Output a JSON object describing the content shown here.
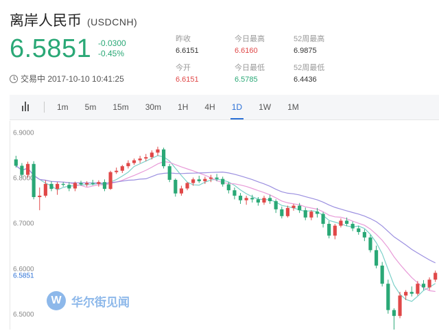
{
  "header": {
    "title": "离岸人民币",
    "symbol": "(USDCNH)"
  },
  "quote": {
    "price": "6.5851",
    "change": "-0.0300",
    "change_pct": "-0.45%",
    "status": "交易中 2017-10-10 10:41:25"
  },
  "stats": [
    {
      "label": "昨收",
      "value": "6.6151",
      "color": "normal"
    },
    {
      "label": "今日最高",
      "value": "6.6160",
      "color": "red"
    },
    {
      "label": "52周最高",
      "value": "6.9875",
      "color": "normal"
    },
    {
      "label": "今开",
      "value": "6.6151",
      "color": "red"
    },
    {
      "label": "今日最低",
      "value": "6.5785",
      "color": "green"
    },
    {
      "label": "52周最低",
      "value": "6.4436",
      "color": "normal"
    }
  ],
  "toolbar": {
    "tabs": [
      "1m",
      "5m",
      "15m",
      "30m",
      "1H",
      "4H",
      "1D",
      "1W",
      "1M"
    ],
    "active": "1D"
  },
  "watermark": {
    "text": "华尔街见闻",
    "glyph": "W"
  },
  "colors": {
    "up": "#e04848",
    "down": "#2aa876",
    "ma1": "#e89ad8",
    "ma2": "#9b8fe0",
    "ma3": "#7ad0c8",
    "current_label": "#2a6fd6"
  },
  "chart_data": {
    "type": "candlestick",
    "ylim": [
      6.465,
      6.925
    ],
    "y_ticks": [
      "6.9000",
      "6.8000",
      "6.7000",
      "6.6000",
      "6.5000"
    ],
    "current_price_label": "6.5851",
    "current_price": 6.5851,
    "candles": [
      [
        6.84,
        6.848,
        6.822,
        6.826
      ],
      [
        6.826,
        6.832,
        6.8,
        6.806
      ],
      [
        6.806,
        6.835,
        6.8,
        6.83
      ],
      [
        6.83,
        6.836,
        6.752,
        6.757
      ],
      [
        6.757,
        6.778,
        6.728,
        6.76
      ],
      [
        6.76,
        6.794,
        6.756,
        6.786
      ],
      [
        6.786,
        6.792,
        6.77,
        6.775
      ],
      [
        6.775,
        6.79,
        6.762,
        6.786
      ],
      [
        6.786,
        6.79,
        6.78,
        6.784
      ],
      [
        6.784,
        6.79,
        6.77,
        6.776
      ],
      [
        6.776,
        6.791,
        6.77,
        6.788
      ],
      [
        6.788,
        6.793,
        6.782,
        6.785
      ],
      [
        6.785,
        6.792,
        6.78,
        6.788
      ],
      [
        6.788,
        6.795,
        6.783,
        6.786
      ],
      [
        6.786,
        6.794,
        6.78,
        6.79
      ],
      [
        6.79,
        6.796,
        6.77,
        6.775
      ],
      [
        6.775,
        6.815,
        6.773,
        6.812
      ],
      [
        6.812,
        6.822,
        6.808,
        6.815
      ],
      [
        6.815,
        6.828,
        6.81,
        6.825
      ],
      [
        6.825,
        6.838,
        6.82,
        6.832
      ],
      [
        6.832,
        6.842,
        6.828,
        6.838
      ],
      [
        6.838,
        6.848,
        6.832,
        6.842
      ],
      [
        6.842,
        6.852,
        6.836,
        6.845
      ],
      [
        6.845,
        6.86,
        6.84,
        6.855
      ],
      [
        6.855,
        6.868,
        6.848,
        6.862
      ],
      [
        6.862,
        6.866,
        6.82,
        6.825
      ],
      [
        6.825,
        6.83,
        6.79,
        6.795
      ],
      [
        6.795,
        6.798,
        6.758,
        6.765
      ],
      [
        6.765,
        6.782,
        6.76,
        6.776
      ],
      [
        6.776,
        6.79,
        6.772,
        6.788
      ],
      [
        6.788,
        6.8,
        6.782,
        6.796
      ],
      [
        6.796,
        6.804,
        6.788,
        6.792
      ],
      [
        6.792,
        6.802,
        6.786,
        6.797
      ],
      [
        6.797,
        6.806,
        6.79,
        6.8
      ],
      [
        6.8,
        6.808,
        6.792,
        6.797
      ],
      [
        6.797,
        6.802,
        6.78,
        6.785
      ],
      [
        6.785,
        6.79,
        6.765,
        6.772
      ],
      [
        6.772,
        6.778,
        6.752,
        6.76
      ],
      [
        6.76,
        6.766,
        6.742,
        6.75
      ],
      [
        6.75,
        6.76,
        6.74,
        6.755
      ],
      [
        6.755,
        6.762,
        6.745,
        6.752
      ],
      [
        6.752,
        6.757,
        6.738,
        6.745
      ],
      [
        6.745,
        6.76,
        6.74,
        6.755
      ],
      [
        6.755,
        6.762,
        6.742,
        6.748
      ],
      [
        6.748,
        6.752,
        6.722,
        6.73
      ],
      [
        6.73,
        6.736,
        6.71,
        6.715
      ],
      [
        6.715,
        6.738,
        6.712,
        6.733
      ],
      [
        6.733,
        6.742,
        6.727,
        6.738
      ],
      [
        6.738,
        6.744,
        6.722,
        6.728
      ],
      [
        6.728,
        6.734,
        6.706,
        6.712
      ],
      [
        6.712,
        6.728,
        6.706,
        6.725
      ],
      [
        6.725,
        6.733,
        6.712,
        6.72
      ],
      [
        6.72,
        6.724,
        6.69,
        6.698
      ],
      [
        6.698,
        6.704,
        6.666,
        6.672
      ],
      [
        6.672,
        6.698,
        6.664,
        6.694
      ],
      [
        6.694,
        6.71,
        6.69,
        6.705
      ],
      [
        6.705,
        6.712,
        6.693,
        6.698
      ],
      [
        6.698,
        6.703,
        6.682,
        6.688
      ],
      [
        6.688,
        6.694,
        6.674,
        6.68
      ],
      [
        6.68,
        6.686,
        6.66,
        6.668
      ],
      [
        6.668,
        6.674,
        6.635,
        6.64
      ],
      [
        6.64,
        6.65,
        6.6,
        6.606
      ],
      [
        6.606,
        6.614,
        6.56,
        6.566
      ],
      [
        6.566,
        6.575,
        6.5,
        6.508
      ],
      [
        6.508,
        6.512,
        6.455,
        6.495
      ],
      [
        6.495,
        6.548,
        6.49,
        6.54
      ],
      [
        6.54,
        6.552,
        6.53,
        6.548
      ],
      [
        6.548,
        6.56,
        6.538,
        6.544
      ],
      [
        6.544,
        6.572,
        6.54,
        6.566
      ],
      [
        6.566,
        6.574,
        6.552,
        6.558
      ],
      [
        6.558,
        6.58,
        6.552,
        6.575
      ],
      [
        6.575,
        6.595,
        6.57,
        6.59
      ]
    ]
  }
}
